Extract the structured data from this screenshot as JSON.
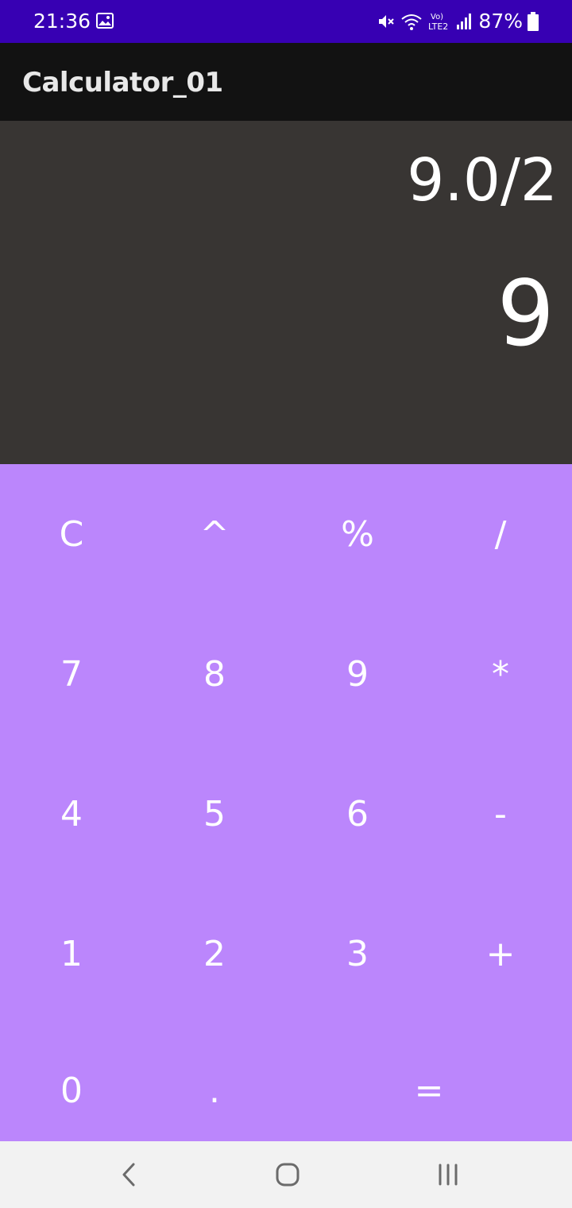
{
  "status_bar": {
    "time": "21:36",
    "battery": "87%",
    "bg_color": "#3700b3"
  },
  "app_bar": {
    "title": "Calculator_01"
  },
  "display": {
    "expression": "9.0/2",
    "result": "9"
  },
  "keypad": {
    "bg_color": "#bb86fc",
    "rows": [
      [
        "C",
        "^",
        "%",
        "/"
      ],
      [
        "7",
        "8",
        "9",
        "*"
      ],
      [
        "4",
        "5",
        "6",
        "-"
      ],
      [
        "1",
        "2",
        "3",
        "+"
      ],
      [
        "0",
        ".",
        "="
      ]
    ]
  },
  "nav_bar": {
    "icons": [
      "back-icon",
      "home-icon",
      "recents-icon"
    ]
  }
}
